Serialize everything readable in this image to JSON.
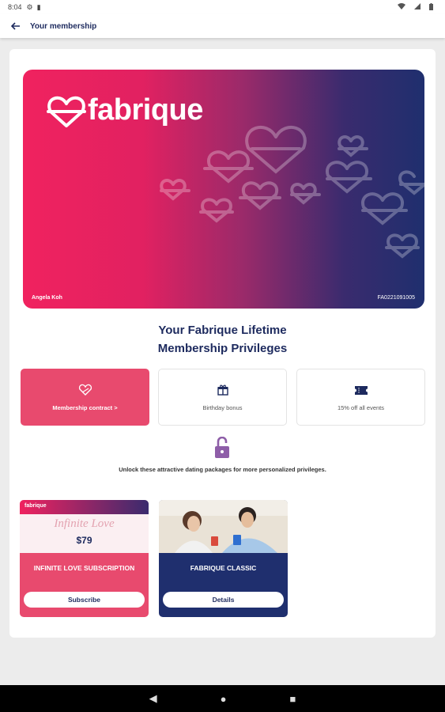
{
  "status_bar": {
    "time": "8:04",
    "icons": [
      "gear-icon",
      "sim-icon",
      "wifi-icon",
      "signal-icon",
      "battery-icon"
    ]
  },
  "app_bar": {
    "title": "Your membership",
    "back_icon": "back-arrow-icon"
  },
  "card": {
    "brand": "fabrique",
    "holder_name": "Angela Koh",
    "member_id": "FA0221091005",
    "gradient": [
      "#f0225f",
      "#1f2f6e"
    ]
  },
  "headline": {
    "line1": "Your Fabrique Lifetime",
    "line2": "Membership Privileges"
  },
  "privileges": [
    {
      "label": "Membership contract >",
      "icon": "contract-heart-icon",
      "active": true
    },
    {
      "label": "Birthday bonus",
      "icon": "gift-icon",
      "active": false
    },
    {
      "label": "15% off all events",
      "icon": "ticket-icon",
      "active": false
    }
  ],
  "unlock": {
    "icon": "unlock-icon",
    "text": "Unlock these attractive dating packages for more personalized privileges."
  },
  "packages": [
    {
      "name": "INFINITE LOVE SUBSCRIPTION",
      "button": "Subscribe",
      "mini_logo": "fabrique",
      "script": "Infinite Love",
      "price": "$79"
    },
    {
      "name": "FABRIQUE CLASSIC",
      "button": "Details"
    }
  ],
  "nav_bar": {
    "back": "◀",
    "home": "●",
    "recents": "■"
  },
  "colors": {
    "navy": "#1d2a5e",
    "pink": "#e84a6e",
    "deep_navy": "#1f2f6e"
  }
}
